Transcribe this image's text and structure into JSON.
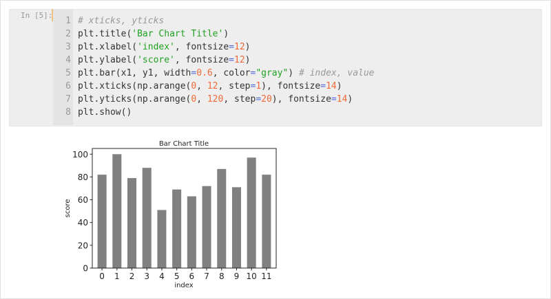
{
  "cell": {
    "prompt": "In [5]:",
    "lines": [
      [
        [
          "comment",
          "# xticks, yticks"
        ]
      ],
      [
        [
          "plain",
          "plt.title("
        ],
        [
          "string",
          "'Bar Chart Title'"
        ],
        [
          "plain",
          ")"
        ]
      ],
      [
        [
          "plain",
          "plt.xlabel("
        ],
        [
          "string",
          "'index'"
        ],
        [
          "plain",
          ", fontsize"
        ],
        [
          "op",
          "="
        ],
        [
          "number",
          "12"
        ],
        [
          "plain",
          ")"
        ]
      ],
      [
        [
          "plain",
          "plt.ylabel("
        ],
        [
          "string",
          "'score'"
        ],
        [
          "plain",
          ", fontsize"
        ],
        [
          "op",
          "="
        ],
        [
          "number",
          "12"
        ],
        [
          "plain",
          ")"
        ]
      ],
      [
        [
          "plain",
          "plt.bar(x1, y1, width"
        ],
        [
          "op",
          "="
        ],
        [
          "number",
          "0.6"
        ],
        [
          "plain",
          ", color"
        ],
        [
          "op",
          "="
        ],
        [
          "string",
          "\"gray\""
        ],
        [
          "plain",
          ") "
        ],
        [
          "comment",
          "# index, value"
        ]
      ],
      [
        [
          "plain",
          "plt.xticks(np.arange("
        ],
        [
          "number",
          "0"
        ],
        [
          "plain",
          ", "
        ],
        [
          "number",
          "12"
        ],
        [
          "plain",
          ", step"
        ],
        [
          "op",
          "="
        ],
        [
          "number",
          "1"
        ],
        [
          "plain",
          "), fontsize"
        ],
        [
          "op",
          "="
        ],
        [
          "number",
          "14"
        ],
        [
          "plain",
          ")"
        ]
      ],
      [
        [
          "plain",
          "plt.yticks(np.arange("
        ],
        [
          "number",
          "0"
        ],
        [
          "plain",
          ", "
        ],
        [
          "number",
          "120"
        ],
        [
          "plain",
          ", step"
        ],
        [
          "op",
          "="
        ],
        [
          "number",
          "20"
        ],
        [
          "plain",
          "), fontsize"
        ],
        [
          "op",
          "="
        ],
        [
          "number",
          "14"
        ],
        [
          "plain",
          ")"
        ]
      ],
      [
        [
          "plain",
          "plt.show()"
        ]
      ]
    ]
  },
  "chart_data": {
    "type": "bar",
    "title": "Bar Chart Title",
    "xlabel": "index",
    "ylabel": "score",
    "categories": [
      "0",
      "1",
      "2",
      "3",
      "4",
      "5",
      "6",
      "7",
      "8",
      "9",
      "10",
      "11"
    ],
    "values": [
      82,
      100,
      79,
      88,
      51,
      69,
      63,
      72,
      87,
      71,
      97,
      82
    ],
    "yticks": [
      "0",
      "20",
      "40",
      "60",
      "80",
      "100"
    ],
    "ylim": [
      0,
      105
    ],
    "xlim": [
      -0.65,
      11.65
    ],
    "bar_width": 0.6,
    "bar_color": "#808080",
    "grid": false
  }
}
